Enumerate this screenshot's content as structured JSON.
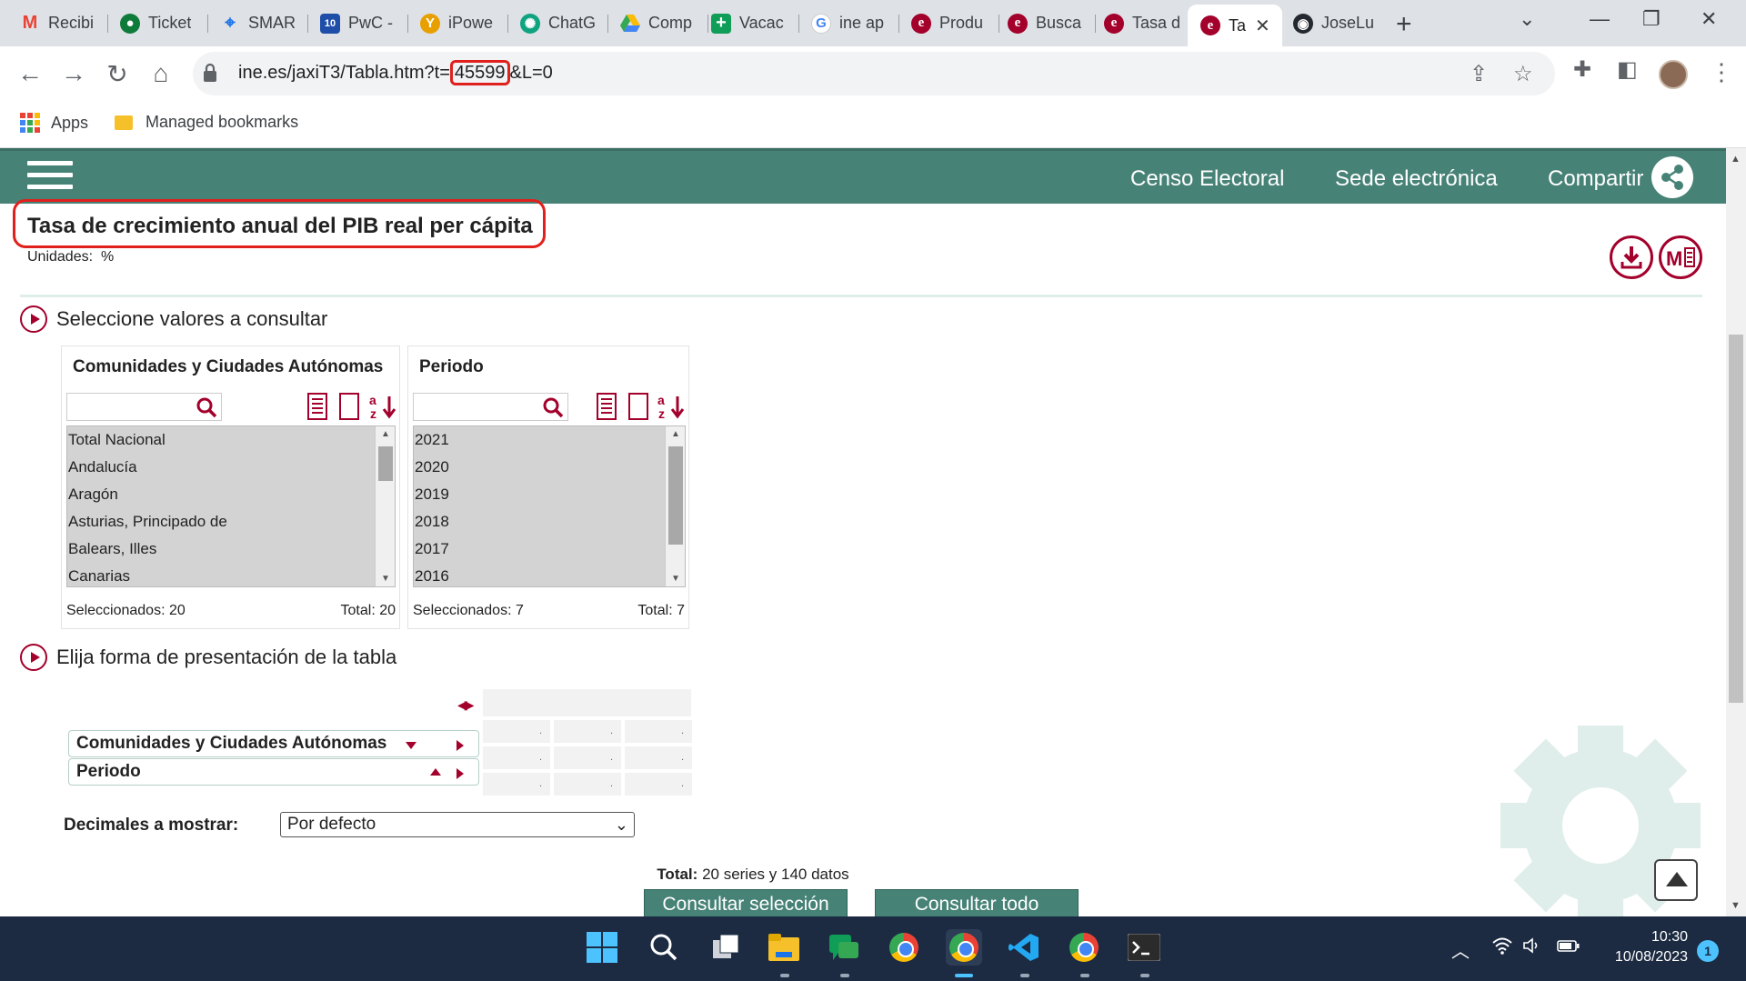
{
  "browser": {
    "tabs": [
      {
        "label": "Recibi",
        "favicon": "gmail-icon",
        "color": "#ea4335"
      },
      {
        "label": "Ticket",
        "favicon": "ticket-icon",
        "color": "#0f7b3a"
      },
      {
        "label": "SMAR",
        "favicon": "location-pin-icon",
        "color": "#1a73e8"
      },
      {
        "label": "PwC -",
        "favicon": "pwc-icon",
        "color": "#1e4ea8"
      },
      {
        "label": "iPowe",
        "favicon": "ipower-icon",
        "color": "#e8a000"
      },
      {
        "label": "ChatG",
        "favicon": "chatgpt-icon",
        "color": "#10a37f"
      },
      {
        "label": "Comp",
        "favicon": "google-drive-icon",
        "color": "#34a853"
      },
      {
        "label": "Vacac",
        "favicon": "plus-icon",
        "color": "#0f9d58"
      },
      {
        "label": "ine ap",
        "favicon": "google-icon",
        "color": "#4285f4"
      },
      {
        "label": "Produ",
        "favicon": "ine-icon",
        "color": "#a3002b"
      },
      {
        "label": "Busca",
        "favicon": "ine-icon",
        "color": "#a3002b"
      },
      {
        "label": "Tasa d",
        "favicon": "ine-icon",
        "color": "#a3002b"
      },
      {
        "label": "Ta",
        "favicon": "ine-icon",
        "color": "#a3002b",
        "active": true
      },
      {
        "label": "JoseLu",
        "favicon": "github-icon",
        "color": "#24292f"
      }
    ],
    "url_prefix": "ine.es/jaxiT3/Tabla.htm?t=",
    "url_highlight": "45599",
    "url_suffix": "&L=0",
    "bookmarks": {
      "apps": "Apps",
      "managed": "Managed bookmarks"
    }
  },
  "header": {
    "links": [
      "Censo Electoral",
      "Sede electrónica",
      "Compartir"
    ]
  },
  "page": {
    "title": "Tasa de crecimiento anual del PIB real per cápita",
    "units_label": "Unidades:",
    "units_value": "%",
    "section_select": "Seleccione valores a consultar",
    "section_layout": "Elija forma de presentación de la tabla"
  },
  "selectors": {
    "regions": {
      "title": "Comunidades y Ciudades Autónomas",
      "items": [
        "Total Nacional",
        "Andalucía",
        "Aragón",
        "Asturias, Principado de",
        "Balears, Illes",
        "Canarias"
      ],
      "selected_text": "Seleccionados: 20",
      "total_text": "Total: 20"
    },
    "periods": {
      "title": "Periodo",
      "items": [
        "2021",
        "2020",
        "2019",
        "2018",
        "2017",
        "2016"
      ],
      "selected_text": "Seleccionados: 7",
      "total_text": "Total: 7"
    }
  },
  "layout": {
    "dimensions": [
      "Comunidades y Ciudades Autónomas",
      "Periodo"
    ],
    "decimals_label": "Decimales a mostrar:",
    "decimals_value": "Por defecto"
  },
  "summary": {
    "total_label": "Total:",
    "total_text": "20 series y  140 datos"
  },
  "buttons": {
    "consult_selection": "Consultar selección",
    "consult_all": "Consultar todo"
  },
  "taskbar": {
    "time": "10:30",
    "date": "10/08/2023",
    "notifications": "1"
  },
  "colors": {
    "ine_green": "#478277",
    "ine_red": "#a3002b",
    "highlight_red": "#e0201c"
  }
}
